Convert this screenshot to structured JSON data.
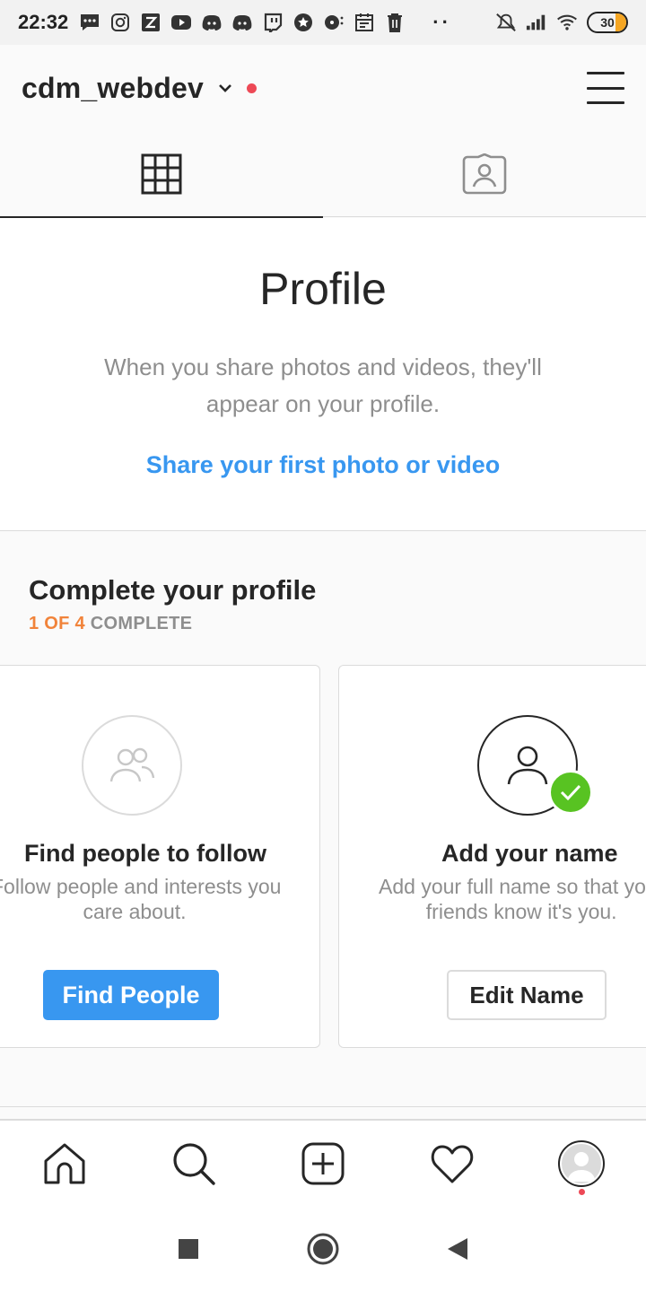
{
  "status_bar": {
    "time": "22:32",
    "battery": "30",
    "notification_icons": [
      "chat-icon",
      "instagram-icon",
      "zomato-icon",
      "youtube-icon",
      "discord-icon",
      "discord-icon",
      "twitch-icon",
      "star-icon",
      "music-icon",
      "calendar-icon",
      "trash-icon"
    ],
    "overflow": "··"
  },
  "header": {
    "username": "cdm_webdev"
  },
  "tabs": [
    {
      "name": "grid",
      "active": true
    },
    {
      "name": "tagged",
      "active": false
    }
  ],
  "empty_state": {
    "title": "Profile",
    "text": "When you share photos and videos, they'll appear on your profile.",
    "link": "Share your first photo or video"
  },
  "complete_profile": {
    "title": "Complete your profile",
    "progress_count": "1 OF 4",
    "progress_label": "COMPLETE",
    "cards": [
      {
        "title": "Find people to follow",
        "desc_line1": "Follow people and interests you",
        "desc_line2": "care about.",
        "button": "Find People",
        "completed": false
      },
      {
        "title": "Add your name",
        "desc_line1": "Add your full name so that your",
        "desc_line2": "friends know it's you.",
        "button": "Edit Name",
        "completed": true
      }
    ]
  },
  "colors": {
    "accent_blue": "#3897f0",
    "progress_orange": "#f1833a",
    "check_green": "#58c322",
    "notification_red": "#ed4956"
  }
}
